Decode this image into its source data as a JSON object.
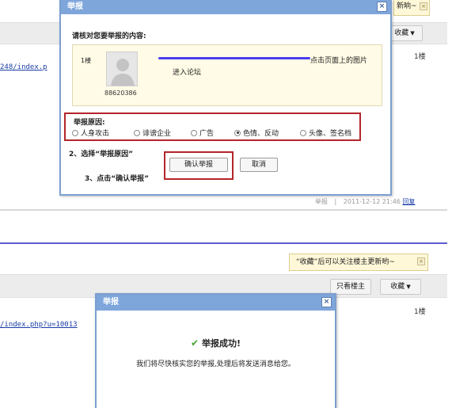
{
  "top": {
    "tip_text": "新晌~",
    "favorite_label": "收藏",
    "favorite_arrow": "▼",
    "floor_label": "1楼",
    "link_text": "248/index.p",
    "footer_report": "举报",
    "footer_sep": "|",
    "footer_time": "2011-12-12 21:46",
    "footer_reply": "回复",
    "dialog": {
      "title": "举报",
      "close": "×",
      "heading": "请核对您要举报的内容:",
      "quote": {
        "floor": "1楼",
        "user_id": "88620386",
        "text_line1": "点击页面上的图片",
        "text_line2": "进入论坛"
      },
      "reason_label": "举报原因:",
      "reasons": [
        {
          "label": "人身攻击",
          "selected": false
        },
        {
          "label": "诽谤企业",
          "selected": false
        },
        {
          "label": "广告",
          "selected": false
        },
        {
          "label": "色情、反动",
          "selected": true
        },
        {
          "label": "头像、签名档",
          "selected": false
        }
      ],
      "step2": "2、选择“举报原因”",
      "step3": "3、点击“确认举报”",
      "confirm_label": "确认举报",
      "cancel_label": "取消"
    }
  },
  "bottom": {
    "tip_text": "“收藏”后可以关注楼主更新哟~",
    "only_owner_label": "只看楼主",
    "favorite_label": "收藏",
    "favorite_arrow": "▼",
    "floor_label": "1楼",
    "link_text": "/index.php?u=10013",
    "dialog": {
      "title": "举报",
      "close": "×",
      "success_icon": "✔",
      "success_text": "举报成功!",
      "message": "我们将尽快核实您的举报,处理后将发送消息给您。"
    }
  },
  "colors": {
    "dialog_title_bg": "#7ea6db",
    "highlight_border": "#b3262b",
    "link": "#1a3da7",
    "tip_bg": "#fff8d8"
  }
}
